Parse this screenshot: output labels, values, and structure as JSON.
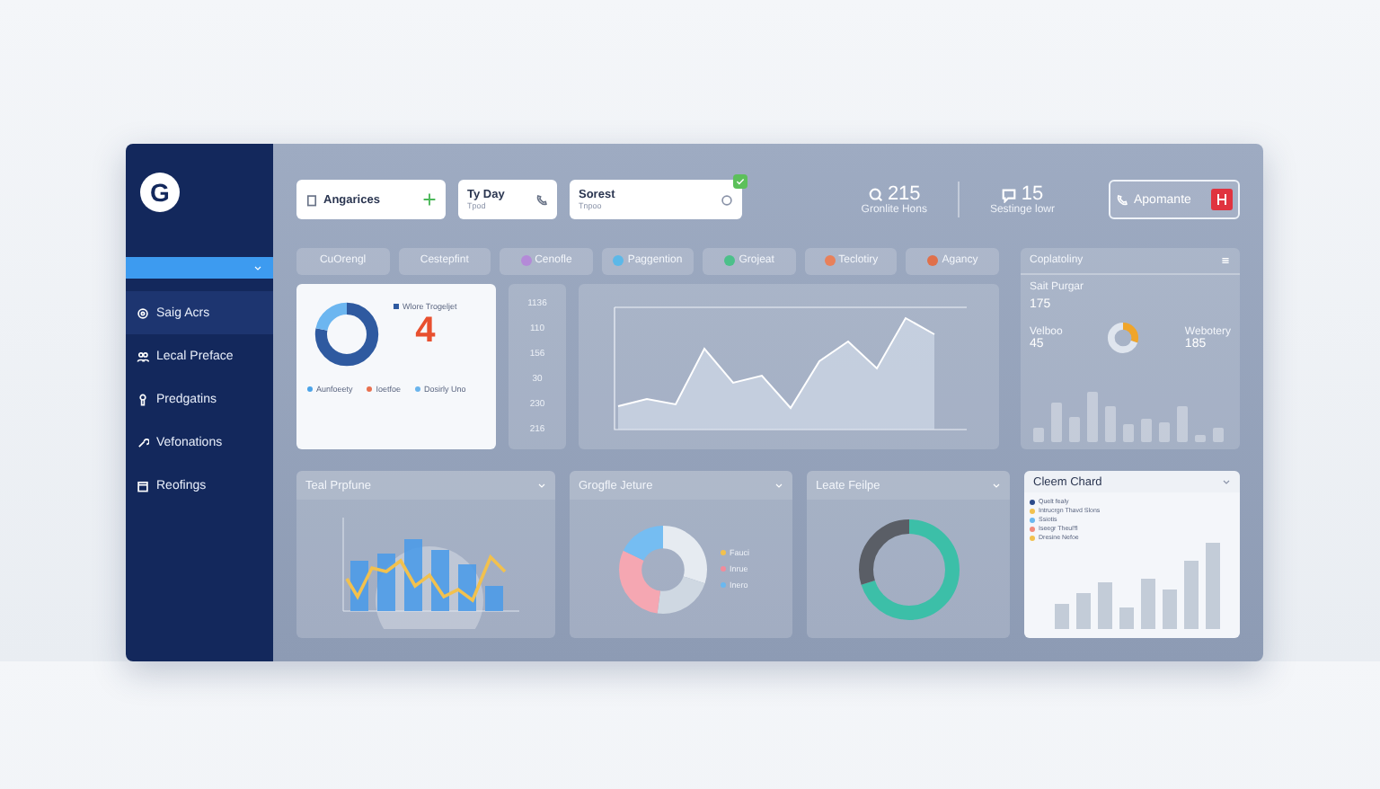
{
  "sidebar": {
    "logo": "G",
    "selector": {
      "expanded": false
    },
    "items": [
      {
        "label": "Saig Acrs",
        "selected": true
      },
      {
        "label": "Lecal Preface",
        "selected": false
      },
      {
        "label": "Predgatins",
        "selected": false
      },
      {
        "label": "Vefonations",
        "selected": false
      },
      {
        "label": "Reofings",
        "selected": false
      }
    ]
  },
  "top_bar": {
    "cards": [
      {
        "kind": "add",
        "title": "Angarices"
      },
      {
        "kind": "phone",
        "title": "Ty Day",
        "subtitle": "Tpod"
      },
      {
        "kind": "status",
        "title": "Sorest",
        "subtitle": "Tnpoo",
        "checked": true
      }
    ],
    "stats": [
      {
        "value": "215",
        "label": "Gronlite Hons"
      },
      {
        "value": "15",
        "label": "Sestinge lowr"
      }
    ],
    "button": "Apomante"
  },
  "tabs": [
    {
      "label": "CuOrengl",
      "selected": false
    },
    {
      "label": "Cestepfint",
      "selected": false
    },
    {
      "label": "Cenofle",
      "color": "#b48ad8",
      "selected": false
    },
    {
      "label": "Paggention",
      "color": "#5cb8e8",
      "selected": false
    },
    {
      "label": "Grojeat",
      "color": "#4cc08a",
      "selected": false
    },
    {
      "label": "Teclotiry",
      "color": "#e8805a",
      "selected": false
    },
    {
      "label": "Agancy",
      "color": "#e0704a",
      "selected": false
    }
  ],
  "summary_card": {
    "title": "Wlore Trogeljet",
    "value": "4",
    "legend": [
      {
        "label": "Aunfoeety",
        "color": "#4aa3e8"
      },
      {
        "label": "Ioetfoe",
        "color": "#e8704f"
      },
      {
        "label": "Dosirly Uno",
        "color": "#6ab4ec"
      }
    ]
  },
  "values_column": [
    "1136",
    "110",
    "156",
    "30",
    "230",
    "216"
  ],
  "right_panel": {
    "title": "Coplatoliny",
    "metric": {
      "label": "Sait Purgar",
      "value": "175"
    },
    "left": {
      "label": "Velboo",
      "value": "45"
    },
    "right": {
      "label": "Webotery",
      "value": "185"
    }
  },
  "bottom_cards": [
    {
      "title": "Teal Prpfune",
      "kind": "combo"
    },
    {
      "title": "Grogfle Jeture",
      "kind": "donut",
      "legend": [
        {
          "label": "Fauci",
          "color": "#f2c14e"
        },
        {
          "label": "Inrue",
          "color": "#f28b9b"
        },
        {
          "label": "Inero",
          "color": "#6ab8f0"
        }
      ]
    },
    {
      "title": "Leate Feilpe",
      "kind": "ring"
    },
    {
      "title": "Cleem Chard",
      "kind": "bars",
      "legend": [
        {
          "label": "Quelt fealy",
          "color": "#2c4a8a"
        },
        {
          "label": "Intrucrgn Thavd Slons",
          "color": "#f2c14e"
        },
        {
          "label": "Ssiotis",
          "color": "#6ab8f0"
        },
        {
          "label": "Iseegr Theul'fl",
          "color": "#f28b7b"
        },
        {
          "label": "Dresine Nefoe",
          "color": "#f2c14e"
        }
      ]
    }
  ]
}
